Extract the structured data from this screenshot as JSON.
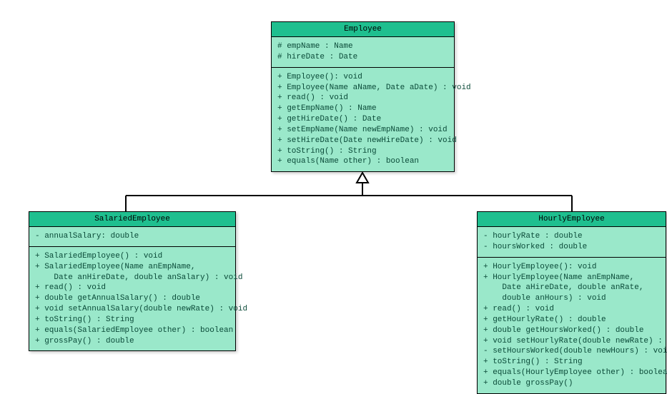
{
  "chart_data": {
    "type": "uml_class_diagram",
    "relationships": [
      {
        "from": "SalariedEmployee",
        "to": "Employee",
        "type": "inheritance"
      },
      {
        "from": "HourlyEmployee",
        "to": "Employee",
        "type": "inheritance"
      }
    ]
  },
  "employee": {
    "title": "Employee",
    "attr0": "# empName : Name",
    "attr1": "# hireDate : Date",
    "m0": "+ Employee(): void",
    "m1": "+ Employee(Name aName, Date aDate) : void",
    "m2": "+ read() : void",
    "m3": "+ getEmpName() : Name",
    "m4": "+ getHireDate() : Date",
    "m5": "+ setEmpName(Name newEmpName) : void",
    "m6": "+ setHireDate(Date newHireDate) : void",
    "m7": "+ toString() : String",
    "m8": "+ equals(Name other) : boolean"
  },
  "salaried": {
    "title": "SalariedEmployee",
    "attr0": "- annualSalary: double",
    "m0": "+ SalariedEmployee() : void",
    "m1": "+ SalariedEmployee(Name anEmpName,",
    "m1b": "    Date anHireDate, double anSalary) : void",
    "m2": "+ read() : void",
    "m3": "+ double getAnnualSalary() : double",
    "m4": "+ void setAnnualSalary(double newRate) : void",
    "m5": "+ toString() : String",
    "m6": "+ equals(SalariedEmployee other) : boolean",
    "m7": "+ grossPay() : double"
  },
  "hourly": {
    "title": "HourlyEmployee",
    "attr0": "- hourlyRate : double",
    "attr1": "- hoursWorked : double",
    "m0": "+ HourlyEmployee(): void",
    "m1": "+ HourlyEmployee(Name anEmpName,",
    "m1b": "    Date aHireDate, double anRate,",
    "m1c": "    double anHours) : void",
    "m2": "+ read() : void",
    "m3": "+ getHourlyRate() : double",
    "m4": "+ double getHoursWorked() : double",
    "m5": "+ void setHourlyRate(double newRate) : void",
    "m6": "- setHoursWorked(double newHours) : void",
    "m7": "+ toString() : String",
    "m8": "+ equals(HourlyEmployee other) : boolean",
    "m9": "+ double grossPay()"
  }
}
